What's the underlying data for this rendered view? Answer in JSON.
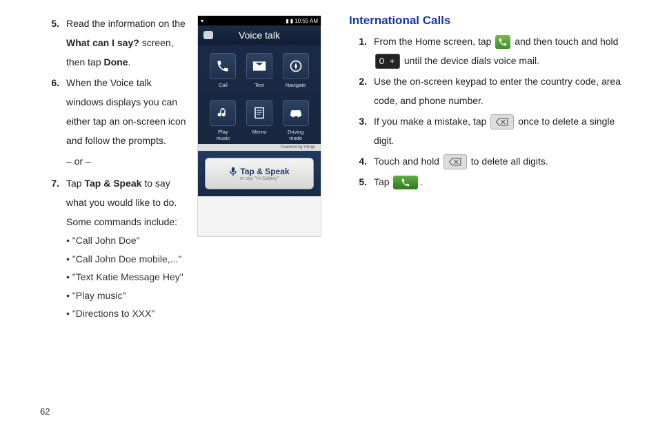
{
  "page_number": "62",
  "left": {
    "steps": {
      "s5": {
        "num": "5.",
        "pre": "Read the information on the ",
        "bold1": "What can I say?",
        "mid": " screen, then tap ",
        "bold2": "Done",
        "post": "."
      },
      "s6": {
        "num": "6.",
        "text": "When the Voice talk windows displays you can either tap an on-screen icon and follow the prompts.",
        "or": "– or –"
      },
      "s7": {
        "num": "7.",
        "pre": "Tap ",
        "bold1": "Tap & Speak",
        "post": " to say what you would like to do. Some commands include:"
      }
    },
    "bullets": [
      "• \"Call John Doe\"",
      "• \"Call John Doe mobile,...\"",
      "• \"Text Katie Message Hey\"",
      "• \"Play music\"",
      "• \"Directions to XXX\""
    ]
  },
  "phone": {
    "status_time": "10:55 AM",
    "title": "Voice talk",
    "tiles": [
      {
        "label": "Call"
      },
      {
        "label": "Text"
      },
      {
        "label": "Navigate"
      },
      {
        "label": "Play\nmusic"
      },
      {
        "label": "Memo"
      },
      {
        "label": "Driving\nmode"
      }
    ],
    "powered": "Powered by Vlingo",
    "tap_main": "Tap & Speak",
    "tap_sub": "or say \"Hi Galaxy\""
  },
  "right": {
    "title": "International Calls",
    "s1": {
      "num": "1.",
      "a": "From the Home screen, tap ",
      "b": " and then touch and hold ",
      "c": " until the device dials voice mail."
    },
    "s2": {
      "num": "2.",
      "text": "Use the on-screen keypad to enter the country code, area code, and phone number."
    },
    "s3": {
      "num": "3.",
      "a": "If you make a mistake, tap ",
      "b": " once to delete a single digit."
    },
    "s4": {
      "num": "4.",
      "a": "Touch and hold ",
      "b": " to delete all digits."
    },
    "s5": {
      "num": "5.",
      "a": "Tap ",
      "period": "."
    }
  },
  "icons": {
    "zero_plus": "0 +"
  }
}
